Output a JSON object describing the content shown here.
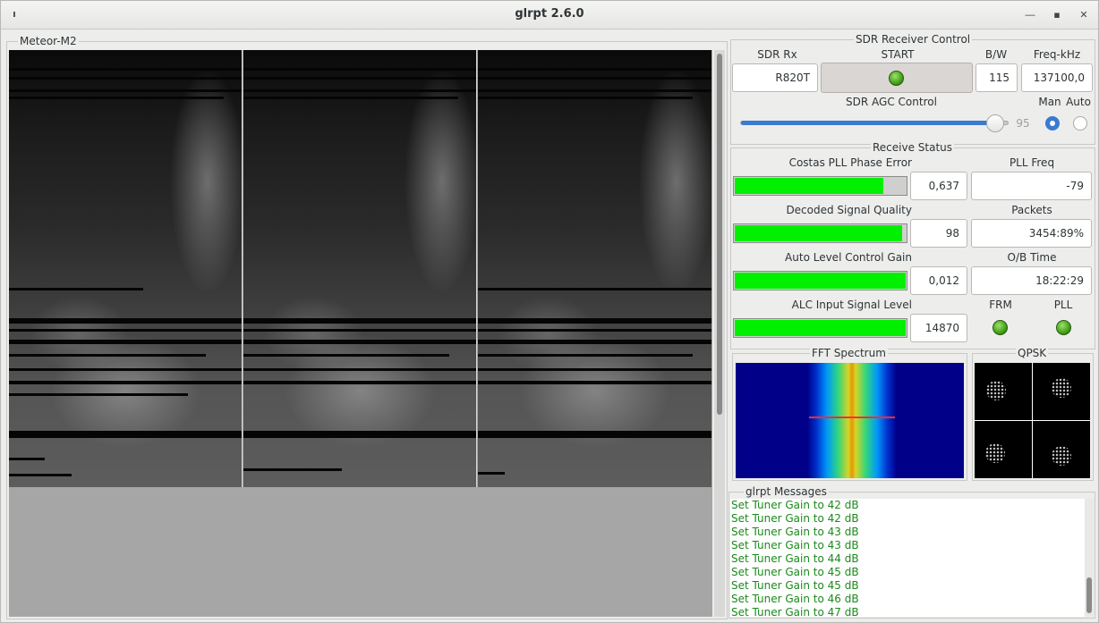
{
  "window": {
    "title": "glrpt 2.6.0"
  },
  "image_frame": {
    "label": "Meteor-M2"
  },
  "sdr_control": {
    "label": "SDR Receiver Control",
    "sdr_rx_label": "SDR Rx",
    "sdr_rx_value": "R820T",
    "start_label": "START",
    "bw_label": "B/W",
    "bw_value": "115",
    "freq_label": "Freq-kHz",
    "freq_value": "137100,0",
    "agc_label": "SDR AGC Control",
    "agc_value": "95",
    "agc_level_fraction": 0.95,
    "man_label": "Man",
    "auto_label": "Auto",
    "mode_selected": "Man"
  },
  "receive_status": {
    "label": "Receive Status",
    "costas_label": "Costas PLL Phase Error",
    "costas_value": "0,637",
    "costas_fill": 0.87,
    "pll_freq_label": "PLL Freq",
    "pll_freq_value": "-79",
    "quality_label": "Decoded Signal Quality",
    "quality_value": "98",
    "quality_fill": 0.98,
    "packets_label": "Packets",
    "packets_value": "3454:89%",
    "alc_gain_label": "Auto Level Control Gain",
    "alc_gain_value": "0,012",
    "alc_gain_fill": 1.0,
    "ob_time_label": "O/B Time",
    "ob_time_value": "18:22:29",
    "alc_input_label": "ALC Input Signal Level",
    "alc_input_value": "14870",
    "alc_input_fill": 1.0,
    "frm_label": "FRM",
    "pll_label": "PLL"
  },
  "fft": {
    "label": "FFT Spectrum"
  },
  "qpsk": {
    "label": "QPSK"
  },
  "messages": {
    "label": "glrpt Messages",
    "lines": [
      "Set Tuner Gain to 42 dB",
      "Set Tuner Gain to 42 dB",
      "Set Tuner Gain to 43 dB",
      "Set Tuner Gain to 43 dB",
      "Set Tuner Gain to 44 dB",
      "Set Tuner Gain to 45 dB",
      "Set Tuner Gain to 45 dB",
      "Set Tuner Gain to 46 dB",
      "Set Tuner Gain to 47 dB"
    ]
  },
  "colors": {
    "bar_fill": "#00f000",
    "message_text": "#1a8a1a",
    "accent": "#3b7ad1"
  },
  "icons": {
    "window_menu": "window-menu-icon",
    "minimize": "minimize-icon",
    "maximize": "maximize-icon",
    "close": "close-icon"
  }
}
